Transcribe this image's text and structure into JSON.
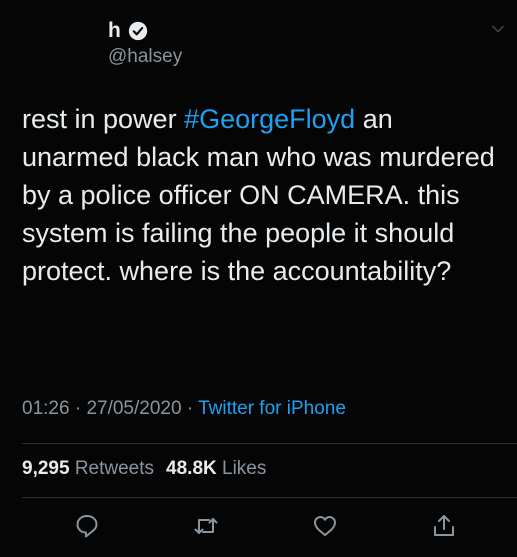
{
  "user": {
    "display_name": "h",
    "handle": "@halsey",
    "verified": true
  },
  "tweet": {
    "text_before": "rest in power ",
    "hashtag": "#GeorgeFloyd",
    "text_after": " an unarmed black man who was murdered by a police officer ON CAMERA. this system is failing the people it should protect. where is the accountability?"
  },
  "meta": {
    "time": "01:26",
    "separator": " · ",
    "date": "27/05/2020",
    "separator2": " · ",
    "source": "Twitter for iPhone"
  },
  "stats": {
    "retweets_count": "9,295",
    "retweets_label": " Retweets",
    "likes_count": "48.8K",
    "likes_label": " Likes"
  },
  "colors": {
    "background": "#050506",
    "text": "#e8ecef",
    "secondary": "#8a959e",
    "accent": "#1da1f2",
    "divider": "#2a2f33"
  },
  "icons": {
    "verified": "verified-badge-icon",
    "more": "chevron-down-icon",
    "reply": "reply-icon",
    "retweet": "retweet-icon",
    "like": "heart-icon",
    "share": "share-icon"
  }
}
